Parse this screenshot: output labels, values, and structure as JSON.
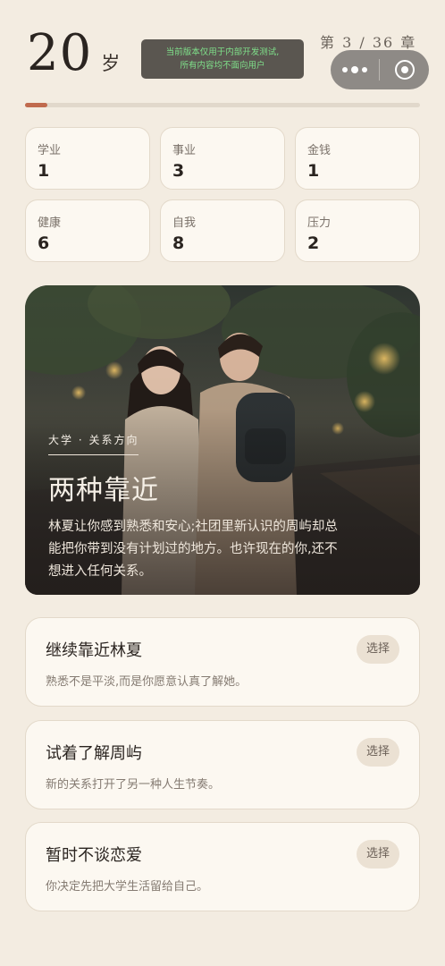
{
  "header": {
    "age": "20",
    "age_unit": "岁",
    "dev_notice_line1": "当前版本仅用于内部开发测试,",
    "dev_notice_line2": "所有内容均不面向用户",
    "chapter_label": "第 3 / 36 章",
    "chapter_progress": 0.0556
  },
  "capsule": {
    "more_icon": "more-dots-icon",
    "close_icon": "target-close-icon"
  },
  "stats": [
    {
      "label": "学业",
      "value": "1"
    },
    {
      "label": "事业",
      "value": "3"
    },
    {
      "label": "金钱",
      "value": "1"
    },
    {
      "label": "健康",
      "value": "6"
    },
    {
      "label": "自我",
      "value": "8"
    },
    {
      "label": "压力",
      "value": "2"
    }
  ],
  "story": {
    "tag": "大学 · 关系方向",
    "title": "两种靠近",
    "description": "林夏让你感到熟悉和安心;社团里新认识的周屿却总能把你带到没有计划过的地方。也许现在的你,还不想进入任何关系。"
  },
  "choices": [
    {
      "title": "继续靠近林夏",
      "description": "熟悉不是平淡,而是你愿意认真了解她。",
      "button": "选择"
    },
    {
      "title": "试着了解周屿",
      "description": "新的关系打开了另一种人生节奏。",
      "button": "选择"
    },
    {
      "title": "暂时不谈恋爱",
      "description": "你决定先把大学生活留给自己。",
      "button": "选择"
    }
  ],
  "colors": {
    "background": "#f3ece1",
    "card": "#fcf8f1",
    "accent": "#c06a4e",
    "dev_notice_text": "#7fe08a"
  }
}
